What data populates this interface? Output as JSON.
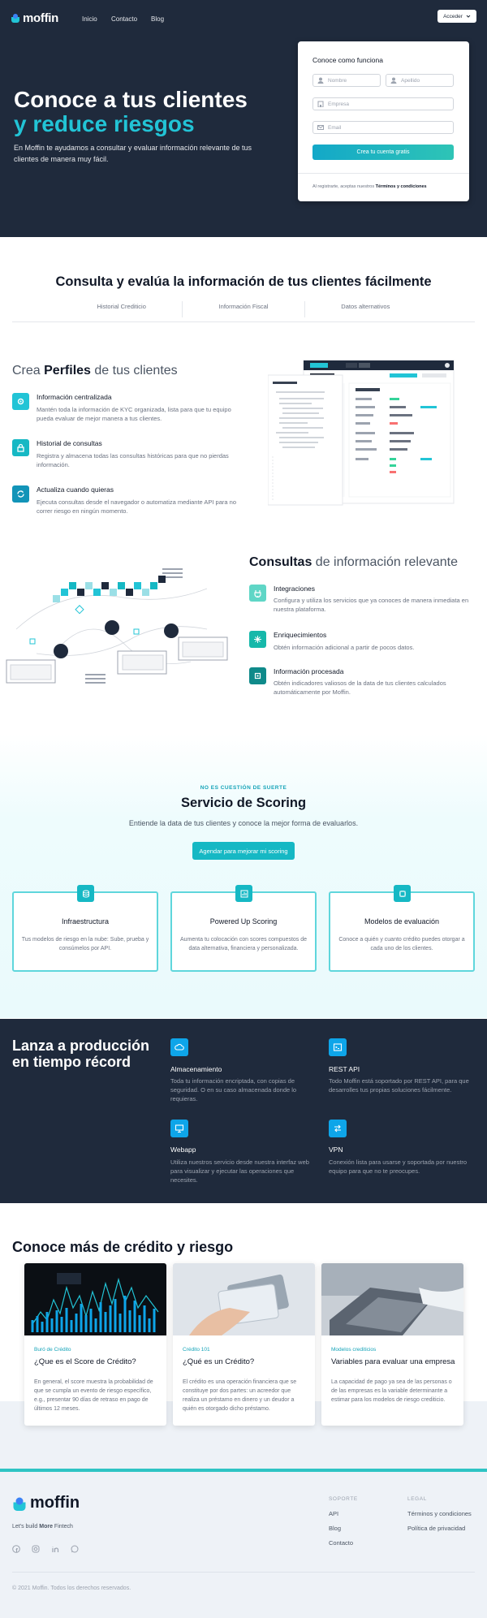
{
  "colors": {
    "navy": "#1f2a3c",
    "teal": "#16b8c4",
    "accent": "#22c4d6"
  },
  "nav": {
    "brand": "moffin",
    "links": [
      "Inicio",
      "Contacto",
      "Blog"
    ],
    "login": "Acceder"
  },
  "hero": {
    "title_line1": "Conoce a tus clientes",
    "title_line2": "y reduce riesgos",
    "description": "En Moffin te ayudamos a consultar y evaluar información relevante de tus clientes de manera muy fácil.",
    "form": {
      "title": "Conoce como funciona",
      "name_placeholder": "Nombre",
      "lastname_placeholder": "Apellido",
      "company_placeholder": "Empresa",
      "email_placeholder": "Email",
      "submit": "Crea tu cuenta gratis",
      "terms_prefix": "Al registrarte, aceptas nuestros",
      "terms_link": "Términos y condiciones"
    }
  },
  "consulta": {
    "title": "Consulta y evalúa la información de tus clientes fácilmente",
    "tabs": [
      "Historial Crediticio",
      "Información Fiscal",
      "Datos alternativos"
    ]
  },
  "perfiles": {
    "title_pre": "Crea ",
    "title_bold": "Perfiles",
    "title_post": " de tus clientes",
    "features": [
      {
        "icon": "gear-icon",
        "title": "Información centralizada",
        "desc": "Mantén toda la información de KYC organizada, lista para que tu equipo pueda evaluar de mejor manera a tus clientes."
      },
      {
        "icon": "lock-icon",
        "title": "Historial de consultas",
        "desc": "Registra y almacena todas las consultas históricas para que no pierdas información."
      },
      {
        "icon": "refresh-icon",
        "title": "Actualiza cuando quieras",
        "desc": "Ejecuta consultas desde el navegador o automatiza mediante API para no correr riesgo en ningún momento."
      }
    ]
  },
  "consultas": {
    "title_bold": "Consultas",
    "title_post": " de información relevante",
    "features": [
      {
        "icon": "plug-icon",
        "title": "Integraciones",
        "desc": "Configura y utiliza los servicios que ya conoces de manera inmediata en nuestra plataforma."
      },
      {
        "icon": "sparkle-icon",
        "title": "Enriquecimientos",
        "desc": "Obtén información adicional a partir de pocos datos."
      },
      {
        "icon": "chip-icon",
        "title": "Información procesada",
        "desc": "Obtén indicadores valiosos de la data de tus clientes calculados automáticamente por Moffin."
      }
    ]
  },
  "scoring": {
    "kicker": "NO ES CUESTIÓN DE SUERTE",
    "title": "Servicio de Scoring",
    "subtitle": "Entiende la data de tus clientes y conoce la mejor forma de evaluarlos.",
    "cta": "Agendar para mejorar mi scoring",
    "cards": [
      {
        "icon": "database-icon",
        "title": "Infraestructura",
        "desc": "Tus modelos de riesgo en la nube: Sube, prueba y consúmelos por API."
      },
      {
        "icon": "chart-icon",
        "title": "Powered Up Scoring",
        "desc": "Aumenta tu colocación con scores compuestos de data alternativa, financiera y personalizada."
      },
      {
        "icon": "model-icon",
        "title": "Modelos de evaluación",
        "desc": "Conoce a quién y cuanto crédito puedes otorgar a cada uno de los clientes."
      }
    ]
  },
  "produccion": {
    "title": "Lanza a producción en tiempo récord",
    "features": [
      {
        "icon": "cloud-icon",
        "title": "Almacenamiento",
        "desc": "Toda tu información encriptada, con copias de seguridad. O en su caso almacenada donde lo requieras."
      },
      {
        "icon": "terminal-icon",
        "title": "REST API",
        "desc": "Todo Moffin está soportado por REST API, para que desarrolles tus propias soluciones fácilmente."
      },
      {
        "icon": "monitor-icon",
        "title": "Webapp",
        "desc": "Utiliza nuestros servicio desde nuestra interfaz web para visualizar y ejecutar las operaciones que necesites."
      },
      {
        "icon": "swap-icon",
        "title": "VPN",
        "desc": "Conexión lista para usarse y soportada por nuestro equipo para que no te preocupes."
      }
    ]
  },
  "blog": {
    "title": "Conoce más de crédito y riesgo",
    "posts": [
      {
        "category": "Buró de Crédito",
        "title": "¿Que es el Score de Crédito?",
        "excerpt": "En general, el score muestra la probabilidad de que se cumpla un evento de riesgo específico, e.g., presentar 90 días de retraso en pago de últimos 12 meses."
      },
      {
        "category": "Crédito 101",
        "title": "¿Qué es un Crédito?",
        "excerpt": "El crédito es una operación financiera que se constituye por dos partes: un acreedor que realiza un préstamo en dinero y un deudor a quién es otorgado dicho préstamo."
      },
      {
        "category": "Modelos crediticios",
        "title": "Variables para evaluar una empresa",
        "excerpt": "La capacidad de pago ya sea de las personas o de las empresas es la variable determinante a estimar para los modelos de riesgo crediticio."
      }
    ]
  },
  "footer": {
    "brand": "moffin",
    "tagline_pre": "Let's build ",
    "tagline_more": "More",
    "tagline_post": " Fintech",
    "support_head": "SOPORTE",
    "support_links": [
      "API",
      "Blog",
      "Contacto"
    ],
    "legal_head": "LEGAL",
    "legal_links": [
      "Términos y condiciones",
      "Política de privacidad"
    ],
    "copyright": "© 2021 Moffin. Todos los derechos reservados."
  }
}
